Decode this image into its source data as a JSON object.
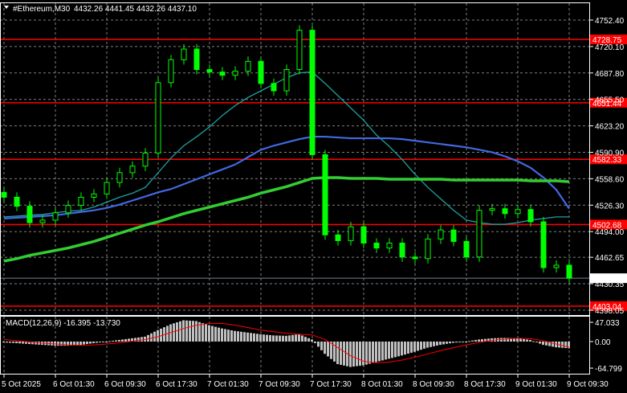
{
  "header": {
    "symbol": "#Ethereum,M30",
    "ohlc": "4432.26 4441.45 4432.26 4437.10"
  },
  "macd_label": "MACD(12,26,9) -16.395 -13.730",
  "colors": {
    "candle": "#00ff00",
    "level_line": "#ff0000",
    "ma_slow": "#32cd32",
    "ma_mid": "#4169e1",
    "ma_fast": "#20a0a0",
    "macd_hist": "#c0c0c0",
    "macd_signal": "#ff0000"
  },
  "chart_data": [
    {
      "type": "candlestick",
      "title": "#Ethereum,M30",
      "price_ticks": [
        "4752.40",
        "4720.10",
        "4687.80",
        "4655.50",
        "4623.20",
        "4590.90",
        "4558.60",
        "4526.30",
        "4494.00",
        "4462.65",
        "4430.35",
        "4398.05"
      ],
      "time_ticks": [
        "5 Oct 2025",
        "6 Oct 01:30",
        "6 Oct 09:30",
        "6 Oct 17:30",
        "7 Oct 01:30",
        "7 Oct 09:30",
        "7 Oct 17:30",
        "8 Oct 01:30",
        "8 Oct 09:30",
        "8 Oct 17:30",
        "9 Oct 01:30",
        "9 Oct 09:30"
      ],
      "closes": [
        4536,
        4525,
        4505,
        4508,
        4517,
        4526,
        4536,
        4540,
        4554,
        4566,
        4574,
        4590,
        4676,
        4704,
        4717,
        4692,
        4689,
        4685,
        4690,
        4702,
        4675,
        4666,
        4692,
        4740,
        4588,
        4490,
        4483,
        4500,
        4480,
        4474,
        4480,
        4463,
        4461,
        4485,
        4496,
        4482,
        4463,
        4520,
        4522,
        4516,
        4521,
        4506,
        4450,
        4453,
        4437.1
      ],
      "ma_slow": [
        4458,
        4461,
        4465,
        4468,
        4471,
        4474,
        4478,
        4482,
        4487,
        4492,
        4497,
        4502,
        4506,
        4511,
        4516,
        4520,
        4524,
        4528,
        4532,
        4536,
        4541,
        4545,
        4549,
        4554,
        4559,
        4560,
        4560,
        4559,
        4559,
        4559,
        4558,
        4558,
        4558,
        4558,
        4558,
        4557,
        4557,
        4557,
        4557,
        4557,
        4557,
        4556,
        4556,
        4556,
        4555
      ],
      "ma_mid": [
        4510,
        4511,
        4512,
        4513,
        4514,
        4516,
        4518,
        4520,
        4523,
        4527,
        4532,
        4537,
        4542,
        4546,
        4552,
        4558,
        4564,
        4570,
        4576,
        4585,
        4594,
        4599,
        4603,
        4607,
        4610,
        4610,
        4609,
        4608,
        4608,
        4608,
        4608,
        4607,
        4605,
        4603,
        4601,
        4599,
        4597,
        4594,
        4591,
        4586,
        4580,
        4572,
        4560,
        4545,
        4522
      ],
      "ma_fast": [
        4512,
        4513,
        4514,
        4515,
        4517,
        4519,
        4520,
        4524,
        4530,
        4536,
        4541,
        4548,
        4566,
        4584,
        4599,
        4610,
        4622,
        4636,
        4648,
        4658,
        4666,
        4674,
        4682,
        4688,
        4689,
        4675,
        4660,
        4645,
        4630,
        4612,
        4598,
        4582,
        4564,
        4548,
        4534,
        4520,
        4508,
        4505,
        4503,
        4503,
        4505,
        4508,
        4510,
        4512,
        4512
      ],
      "levels": [
        "4728.75",
        "4651.44",
        "4582.33",
        "4502.68",
        "4403.04"
      ],
      "current_price": "4437.10",
      "ylim": [
        4395,
        4760
      ]
    },
    {
      "type": "bar",
      "title": "MACD(12,26,9)",
      "ticks": [
        "47.033",
        "0.00",
        "-64.799"
      ],
      "histogram": [
        -2,
        -4,
        -6,
        -8,
        -10,
        -10,
        -8,
        -4,
        0,
        4,
        8,
        12,
        28,
        42,
        52,
        50,
        40,
        32,
        26,
        22,
        18,
        15,
        14,
        18,
        5,
        -30,
        -55,
        -62,
        -58,
        -50,
        -42,
        -34,
        -25,
        -15,
        -8,
        -3,
        0,
        5,
        8,
        9,
        8,
        4,
        -8,
        -14,
        -16.395
      ],
      "signal": [
        5,
        2,
        -1,
        -4,
        -6,
        -8,
        -9,
        -8,
        -6,
        -3,
        1,
        5,
        12,
        22,
        32,
        40,
        44,
        44,
        40,
        34,
        28,
        24,
        20,
        18,
        16,
        5,
        -15,
        -35,
        -48,
        -52,
        -50,
        -45,
        -38,
        -30,
        -22,
        -15,
        -8,
        -2,
        3,
        6,
        8,
        7,
        2,
        -6,
        -13.73
      ]
    }
  ]
}
